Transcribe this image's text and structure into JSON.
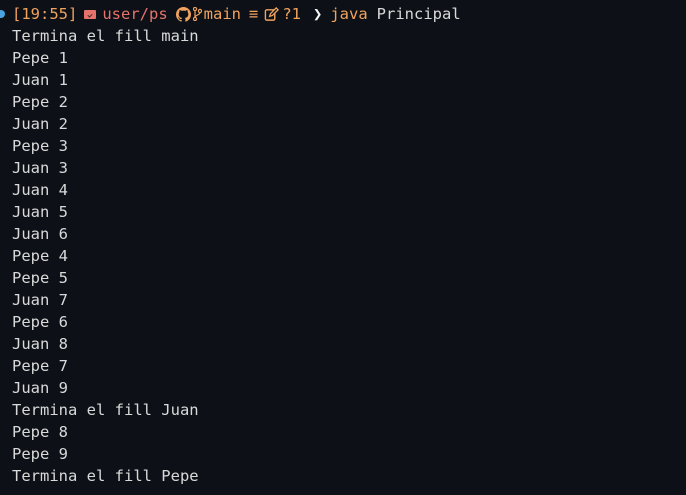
{
  "prompt": {
    "time": "[19:55]",
    "path": "user/ps",
    "branch": "main",
    "sync_symbol": "≡",
    "status": "?1",
    "chevron": "❯",
    "command": "java",
    "argument": "Principal",
    "icons": [
      "folder-icon",
      "github-icon",
      "branch-icon",
      "edit-icon"
    ]
  },
  "output": [
    "Termina el fill main",
    "Pepe 1",
    "Juan 1",
    "Pepe 2",
    "Juan 2",
    "Pepe 3",
    "Juan 3",
    "Juan 4",
    "Juan 5",
    "Juan 6",
    "Pepe 4",
    "Pepe 5",
    "Juan 7",
    "Pepe 6",
    "Juan 8",
    "Pepe 7",
    "Juan 9",
    "Termina el fill Juan",
    "Pepe 8",
    "Pepe 9",
    "Termina el fill Pepe"
  ],
  "colors": {
    "background": "#0d1117",
    "text": "#d9d9d9",
    "accent_orange": "#f0a35e",
    "accent_red": "#e5736b",
    "status_dot": "#4aa3df"
  }
}
